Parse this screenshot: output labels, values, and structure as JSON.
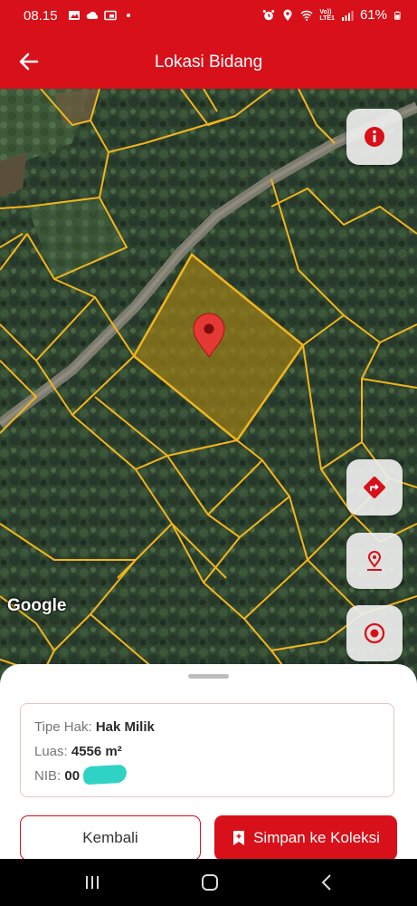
{
  "status_bar": {
    "time": "08.15",
    "battery": "61%",
    "network_label": "Vo))\nLTE1",
    "icons": [
      "image-icon",
      "cloud-icon",
      "cast-icon",
      "dot-icon",
      "alarm-icon",
      "location-icon",
      "wifi-icon",
      "signal-icon",
      "battery-icon"
    ]
  },
  "app_bar": {
    "title": "Lokasi Bidang",
    "back_icon": "arrow-left-icon"
  },
  "map": {
    "attribution": "Google",
    "marker_icon": "map-pin-icon",
    "buttons": [
      {
        "name": "info-button",
        "icon": "info-icon"
      },
      {
        "name": "directions-button",
        "icon": "directions-icon"
      },
      {
        "name": "my-location-button",
        "icon": "location-pin-icon"
      },
      {
        "name": "center-target-button",
        "icon": "target-icon"
      }
    ],
    "accent_color": "#d81019",
    "parcel_line_color": "#f2b51c"
  },
  "parcel_info": {
    "tipe_hak_label": "Tipe Hak:",
    "tipe_hak_value": "Hak Milik",
    "luas_label": "Luas:",
    "luas_value": "4556 m²",
    "nib_label": "NIB:",
    "nib_value": "00"
  },
  "actions": {
    "back_label": "Kembali",
    "save_label": "Simpan ke Koleksi",
    "save_icon": "bookmark-plus-icon"
  },
  "nav_bar": {
    "icons": [
      "recent-apps-icon",
      "home-icon",
      "back-icon"
    ]
  }
}
